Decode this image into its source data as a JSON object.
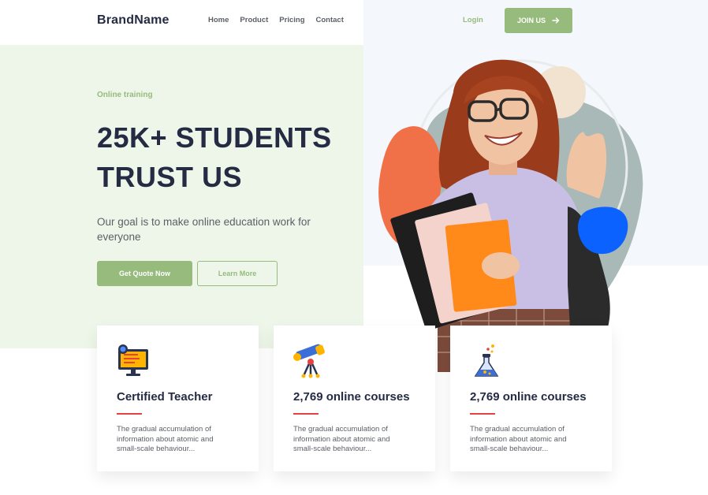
{
  "header": {
    "brand": "BrandName",
    "nav": [
      "Home",
      "Product",
      "Pricing",
      "Contact"
    ],
    "login": "Login",
    "join": "JOIN US"
  },
  "hero": {
    "eyebrow": "Online training",
    "headline_line1": "25K+ STUDENTS",
    "headline_line2": "TRUST US",
    "subtitle": "Our goal is to make online education work for everyone",
    "primary_button": "Get Quote Now",
    "secondary_button": "Learn More"
  },
  "cards": [
    {
      "icon": "computer-checklist-icon",
      "title": "Certified Teacher",
      "desc": "The gradual accumulation of information about atomic and small-scale behaviour..."
    },
    {
      "icon": "telescope-icon",
      "title": "2,769 online courses",
      "desc": "The gradual accumulation of information about atomic and small-scale behaviour..."
    },
    {
      "icon": "flask-icon",
      "title": "2,769 online courses",
      "desc": "The gradual accumulation of information about atomic and small-scale behaviour..."
    }
  ],
  "colors": {
    "primary": "#96bb7c",
    "heading": "#252b42",
    "text": "#5b5f66",
    "accent_red": "#e74040",
    "hero_bg": "#eef6ea"
  }
}
